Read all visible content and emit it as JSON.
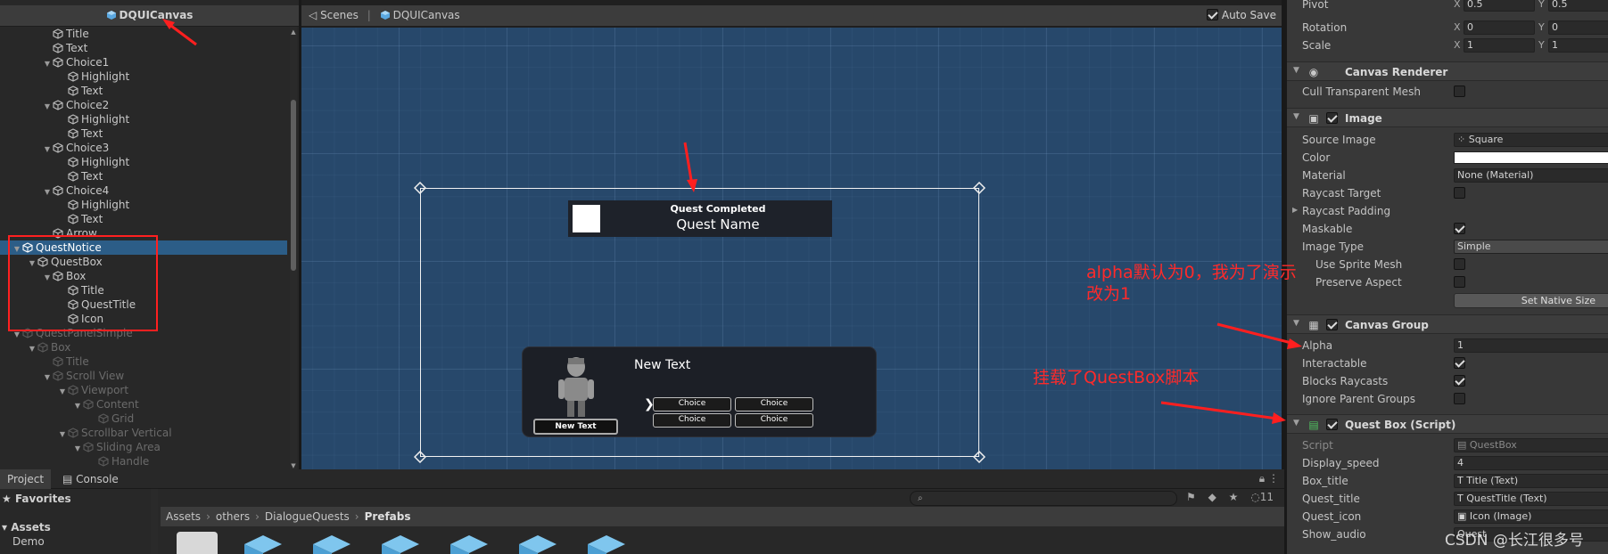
{
  "hierarchy": {
    "title": "DQUICanvas",
    "rows": [
      {
        "label": "Title",
        "depth": 3,
        "fold": "",
        "dim": false,
        "selected": false
      },
      {
        "label": "Text",
        "depth": 3,
        "fold": "",
        "dim": false,
        "selected": false
      },
      {
        "label": "Choice1",
        "depth": 3,
        "fold": "▼",
        "dim": false,
        "selected": false
      },
      {
        "label": "Highlight",
        "depth": 4,
        "fold": "",
        "dim": false,
        "selected": false
      },
      {
        "label": "Text",
        "depth": 4,
        "fold": "",
        "dim": false,
        "selected": false
      },
      {
        "label": "Choice2",
        "depth": 3,
        "fold": "▼",
        "dim": false,
        "selected": false
      },
      {
        "label": "Highlight",
        "depth": 4,
        "fold": "",
        "dim": false,
        "selected": false
      },
      {
        "label": "Text",
        "depth": 4,
        "fold": "",
        "dim": false,
        "selected": false
      },
      {
        "label": "Choice3",
        "depth": 3,
        "fold": "▼",
        "dim": false,
        "selected": false
      },
      {
        "label": "Highlight",
        "depth": 4,
        "fold": "",
        "dim": false,
        "selected": false
      },
      {
        "label": "Text",
        "depth": 4,
        "fold": "",
        "dim": false,
        "selected": false
      },
      {
        "label": "Choice4",
        "depth": 3,
        "fold": "▼",
        "dim": false,
        "selected": false
      },
      {
        "label": "Highlight",
        "depth": 4,
        "fold": "",
        "dim": false,
        "selected": false
      },
      {
        "label": "Text",
        "depth": 4,
        "fold": "",
        "dim": false,
        "selected": false
      },
      {
        "label": "Arrow",
        "depth": 3,
        "fold": "",
        "dim": false,
        "selected": false
      },
      {
        "label": "QuestNotice",
        "depth": 1,
        "fold": "▼",
        "dim": false,
        "selected": true
      },
      {
        "label": "QuestBox",
        "depth": 2,
        "fold": "▼",
        "dim": false,
        "selected": false
      },
      {
        "label": "Box",
        "depth": 3,
        "fold": "▼",
        "dim": false,
        "selected": false
      },
      {
        "label": "Title",
        "depth": 4,
        "fold": "",
        "dim": false,
        "selected": false
      },
      {
        "label": "QuestTitle",
        "depth": 4,
        "fold": "",
        "dim": false,
        "selected": false
      },
      {
        "label": "Icon",
        "depth": 4,
        "fold": "",
        "dim": false,
        "selected": false
      },
      {
        "label": "QuestPanelSimple",
        "depth": 1,
        "fold": "▼",
        "dim": true,
        "selected": false
      },
      {
        "label": "Box",
        "depth": 2,
        "fold": "▼",
        "dim": true,
        "selected": false
      },
      {
        "label": "Title",
        "depth": 3,
        "fold": "",
        "dim": true,
        "selected": false
      },
      {
        "label": "Scroll View",
        "depth": 3,
        "fold": "▼",
        "dim": true,
        "selected": false
      },
      {
        "label": "Viewport",
        "depth": 4,
        "fold": "▼",
        "dim": true,
        "selected": false
      },
      {
        "label": "Content",
        "depth": 5,
        "fold": "▼",
        "dim": true,
        "selected": false
      },
      {
        "label": "Grid",
        "depth": 6,
        "fold": "",
        "dim": true,
        "selected": false
      },
      {
        "label": "Scrollbar Vertical",
        "depth": 4,
        "fold": "▼",
        "dim": true,
        "selected": false
      },
      {
        "label": "Sliding Area",
        "depth": 5,
        "fold": "▼",
        "dim": true,
        "selected": false
      },
      {
        "label": "Handle",
        "depth": 6,
        "fold": "",
        "dim": true,
        "selected": false
      }
    ]
  },
  "scene": {
    "tab_label": "Scenes",
    "canvas_label": "DQUICanvas",
    "auto_save_label": "Auto Save",
    "quest_box_title": "Quest Completed",
    "quest_name": "Quest Name",
    "dialogue_text": "New Text",
    "speaker_button": "New Text",
    "choices": [
      "Choice",
      "Choice",
      "Choice",
      "Choice"
    ]
  },
  "inspector": {
    "pivot": {
      "label": "Pivot",
      "x": "0.5",
      "y": "0.5"
    },
    "rotation": {
      "label": "Rotation",
      "x": "0",
      "y": "0"
    },
    "scale": {
      "label": "Scale",
      "x": "1",
      "y": "1"
    },
    "canvas_renderer": {
      "title": "Canvas Renderer",
      "cull_label": "Cull Transparent Mesh"
    },
    "image": {
      "title": "Image",
      "source_image_label": "Source Image",
      "source_image_value": "Square",
      "color_label": "Color",
      "material_label": "Material",
      "material_value": "None (Material)",
      "raycast_target_label": "Raycast Target",
      "raycast_padding_label": "Raycast Padding",
      "maskable_label": "Maskable",
      "image_type_label": "Image Type",
      "image_type_value": "Simple",
      "use_sprite_mesh_label": "Use Sprite Mesh",
      "preserve_aspect_label": "Preserve Aspect",
      "set_native_size_label": "Set Native Size"
    },
    "canvas_group": {
      "title": "Canvas Group",
      "alpha_label": "Alpha",
      "alpha_value": "1",
      "interactable_label": "Interactable",
      "blocks_raycasts_label": "Blocks Raycasts",
      "ignore_parent_groups_label": "Ignore Parent Groups"
    },
    "quest_box_script": {
      "title": "Quest Box (Script)",
      "script_label": "Script",
      "script_value": "QuestBox",
      "display_speed_label": "Display_speed",
      "display_speed_value": "4",
      "box_title_label": "Box_title",
      "box_title_value": "Title (Text)",
      "quest_title_label": "Quest_title",
      "quest_title_value": "QuestTitle (Text)",
      "quest_icon_label": "Quest_icon",
      "quest_icon_value": "Icon (Image)",
      "show_audio_label": "Show_audio",
      "show_audio_value": "Quest"
    }
  },
  "project": {
    "tab_project": "Project",
    "tab_console": "Console",
    "favorites_label": "Favorites",
    "assets_label": "Assets",
    "demo_label": "Demo",
    "path": [
      "Assets",
      "others",
      "DialogueQuests",
      "Prefabs"
    ],
    "hidden_count": "11"
  },
  "annotations": {
    "alpha_note_line1": "alpha默认为0，我为了演示",
    "alpha_note_line2": "改为1",
    "script_note": "挂载了QuestBox脚本",
    "watermark": "CSDN @长江很多号"
  },
  "colors": {
    "selection": "#2c5d87",
    "scene_background": "#27486b",
    "annotation_red": "#ff2a2a"
  }
}
